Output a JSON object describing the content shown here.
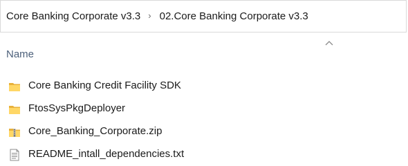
{
  "breadcrumb": {
    "items": [
      {
        "label": "Core Banking Corporate v3.3"
      },
      {
        "label": "02.Core Banking Corporate v3.3"
      }
    ],
    "separator_icon": "chevron-right-icon"
  },
  "columns": {
    "name": {
      "label": "Name",
      "sort": "ascending"
    }
  },
  "files": [
    {
      "name": "Core Banking Credit Facility SDK",
      "icon": "folder-icon"
    },
    {
      "name": "FtosSysPkgDeployer",
      "icon": "folder-icon"
    },
    {
      "name": "Core_Banking_Corporate.zip",
      "icon": "zip-folder-icon"
    },
    {
      "name": "README_intall_dependencies.txt",
      "icon": "text-file-icon"
    }
  ],
  "colors": {
    "header_text": "#4c607a",
    "folder": "#ffd766",
    "folder_dark": "#e8b13a"
  }
}
